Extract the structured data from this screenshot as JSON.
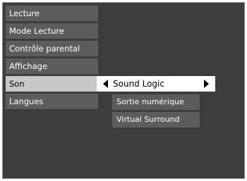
{
  "menu": {
    "items": [
      {
        "label": "Lecture"
      },
      {
        "label": "Mode Lecture"
      },
      {
        "label": "Contrôle parental"
      },
      {
        "label": "Affichage"
      },
      {
        "label": "Son"
      },
      {
        "label": "Langues"
      }
    ],
    "active_index": 4
  },
  "submenu": {
    "selected_option": "Sound Logic",
    "items": [
      {
        "label": "Sortie numérique"
      },
      {
        "label": "Virtual Surround"
      }
    ]
  },
  "colors": {
    "background": "#3d3d3d",
    "item": "#5c5c5c",
    "active_item": "#c8c8c8",
    "selected_option": "#ffffff"
  },
  "icons": {
    "previous": "triangle-left-icon",
    "next": "triangle-right-icon"
  }
}
